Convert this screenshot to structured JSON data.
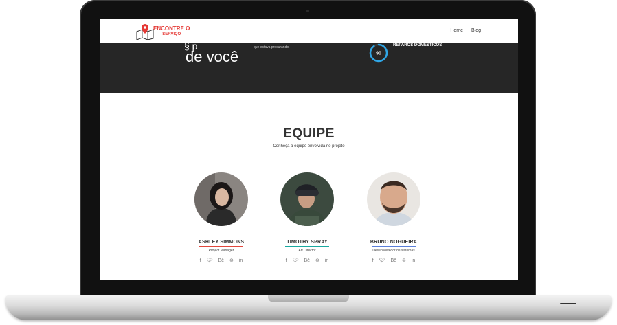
{
  "brand": {
    "name_line1": "ENCONTRE O",
    "name_line2": "SERVIÇO",
    "color": "#e53935"
  },
  "nav": {
    "items": [
      "Home",
      "Blog"
    ]
  },
  "hero": {
    "headline_fragment": "de você",
    "subtext_fragment": "que estava procurando.",
    "counter_value": "90",
    "counter_label": "REPAROS DOMÉSTICOS",
    "counter_color": "#2fa6e6"
  },
  "team": {
    "title": "EQUIPE",
    "subtitle": "Conheça a equipe envolvida no projeto",
    "members": [
      {
        "name": "ASHLEY SIMMONS",
        "role": "Project Manager",
        "accent": "#e2473d"
      },
      {
        "name": "TIMOTHY SPRAY",
        "role": "Art Director",
        "accent": "#1aa9a0"
      },
      {
        "name": "BRUNO NOGUEIRA",
        "role": "Desenvolvedor de sistemas",
        "accent": "#5b7fd9"
      }
    ],
    "socials": [
      "f",
      "t",
      "Bē",
      "⊛",
      "in"
    ],
    "social_icons": [
      "facebook-icon",
      "twitter-icon",
      "behance-icon",
      "dribbble-icon",
      "linkedin-icon"
    ]
  }
}
